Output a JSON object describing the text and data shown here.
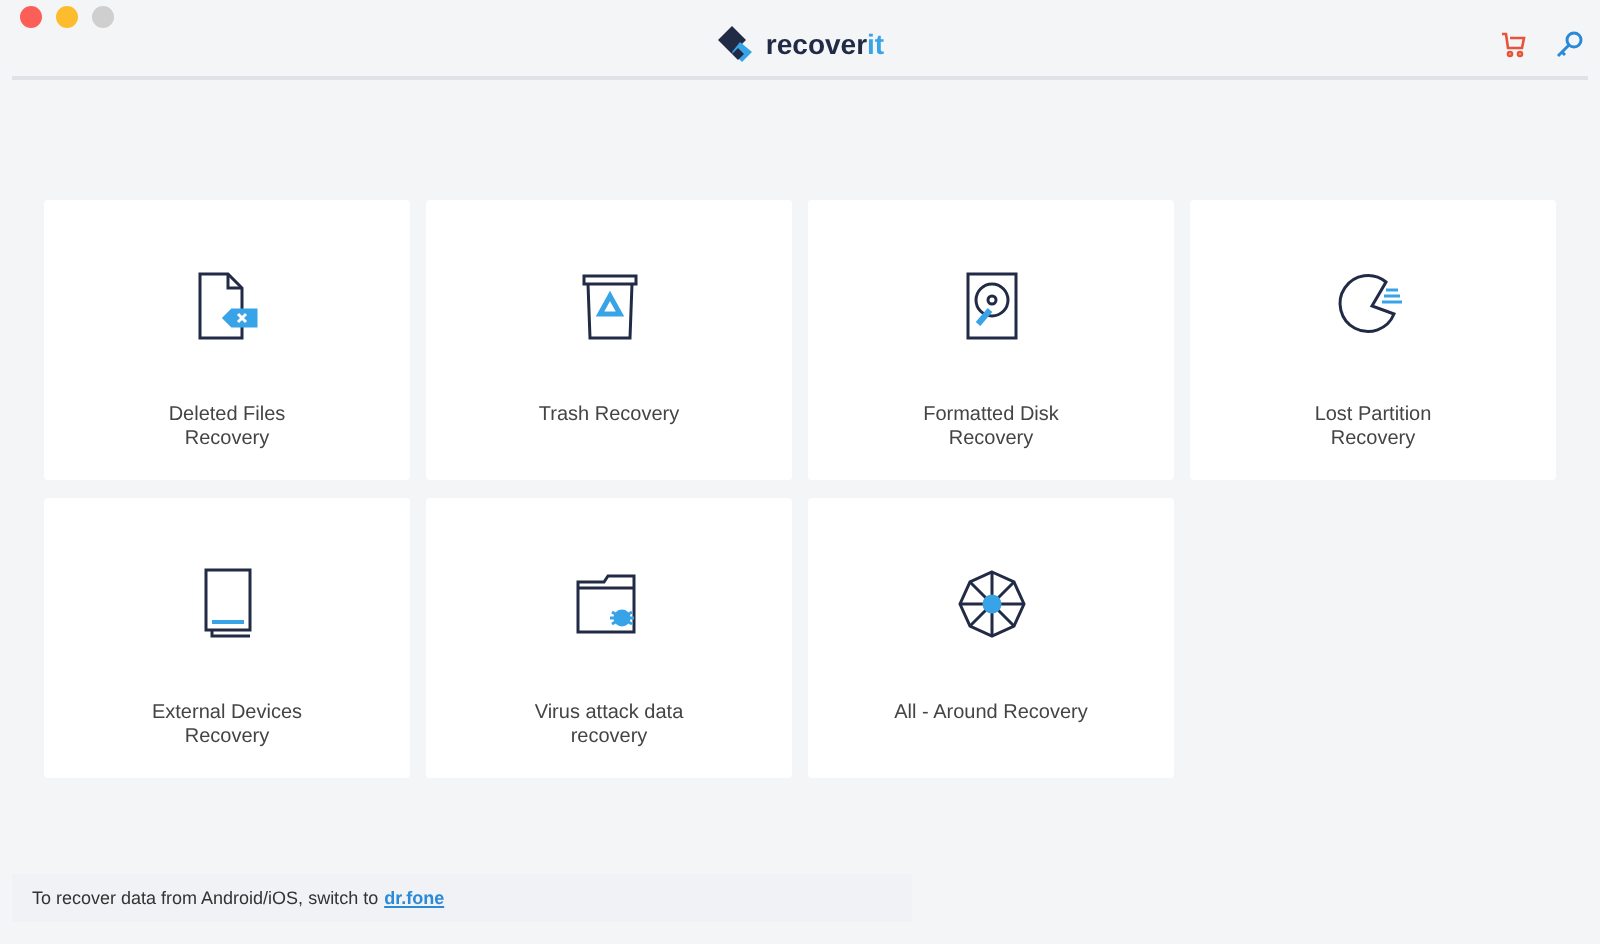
{
  "window": {
    "logo": {
      "text": "recover",
      "accent": "it"
    }
  },
  "cards": [
    {
      "kind": "deleted",
      "label": "Deleted Files Recovery"
    },
    {
      "kind": "trash",
      "label": "Trash Recovery"
    },
    {
      "kind": "disk",
      "label": "Formatted Disk Recovery"
    },
    {
      "kind": "partition",
      "label": "Lost Partition Recovery"
    },
    {
      "kind": "external",
      "label": "External Devices Recovery"
    },
    {
      "kind": "virus",
      "label": "Virus attack data recovery"
    },
    {
      "kind": "all",
      "label": "All - Around Recovery"
    }
  ],
  "footer": {
    "text": "To recover data from Android/iOS, switch to",
    "link": "dr.fone"
  }
}
